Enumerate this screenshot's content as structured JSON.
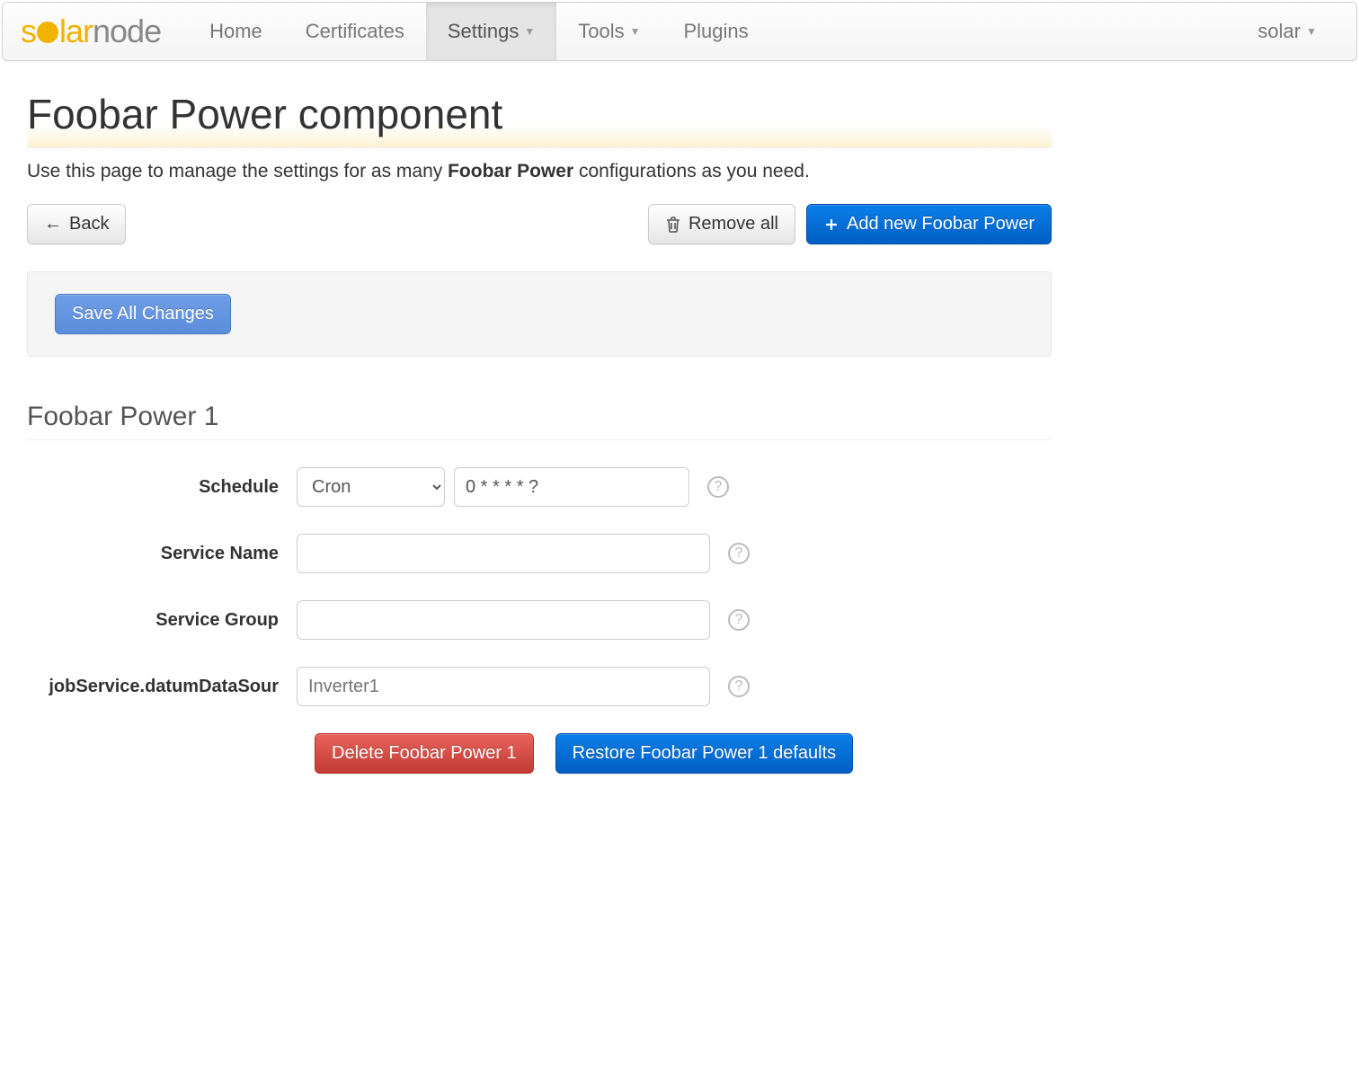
{
  "brand": {
    "solar": "solar",
    "node": "node"
  },
  "nav": {
    "items": [
      {
        "label": "Home"
      },
      {
        "label": "Certificates"
      },
      {
        "label": "Settings",
        "dropdown": true,
        "active": true
      },
      {
        "label": "Tools",
        "dropdown": true
      },
      {
        "label": "Plugins"
      }
    ],
    "user": {
      "label": "solar",
      "dropdown": true
    }
  },
  "page": {
    "title": "Foobar Power component",
    "subtitle_prefix": "Use this page to manage the settings for as many ",
    "subtitle_strong": "Foobar Power",
    "subtitle_suffix": " configurations as you need."
  },
  "toolbar": {
    "back_label": "Back",
    "remove_all_label": "Remove all",
    "add_new_label": "Add new Foobar Power"
  },
  "save_bar": {
    "save_all_label": "Save All Changes"
  },
  "section": {
    "title": "Foobar Power 1",
    "fields": {
      "schedule": {
        "label": "Schedule",
        "select_value": "Cron",
        "select_options": [
          "Cron"
        ],
        "cron_value": "0 * * * * ?"
      },
      "service_name": {
        "label": "Service Name",
        "value": ""
      },
      "service_group": {
        "label": "Service Group",
        "value": ""
      },
      "job_service": {
        "label": "jobService.datumDataSour",
        "value": "",
        "placeholder": "Inverter1"
      }
    },
    "actions": {
      "delete_label": "Delete Foobar Power 1",
      "restore_label": "Restore Foobar Power 1 defaults"
    }
  },
  "icons": {
    "back_arrow": "←",
    "help": "?"
  }
}
